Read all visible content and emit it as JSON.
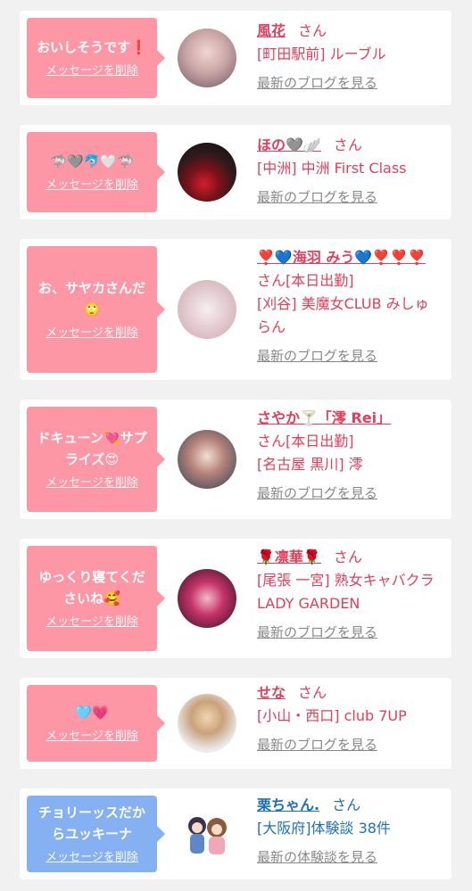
{
  "colors": {
    "pink_bubble": "#fd96a5",
    "blue_bubble": "#85b1f2",
    "name_red": "#e23f5b",
    "name_blue": "#1e6fb5",
    "link_gray": "#888888"
  },
  "delete_label": "メッセージを削除",
  "cards": [
    {
      "message": "おいしそうです❗",
      "name": "風花",
      "honorific": "さん",
      "shop": "[町田駅前] ルーブル",
      "link": "最新のブログを見る"
    },
    {
      "message": "🦈🩶🐬🤍🦈",
      "name": "ほの🩶🪽",
      "honorific": "さん",
      "shop": "[中洲] 中洲 First Class",
      "link": "最新のブログを見る"
    },
    {
      "message": "お、サヤカさんだ🙄",
      "name": "❣️💙海羽 みう💙❣️❣️❣️",
      "honorific": "さん[本日出勤]",
      "shop": "[刈谷] 美魔女CLUB みしゅらん",
      "link": "最新のブログを見る"
    },
    {
      "message": "ドキューン💘サプライズ😍",
      "name": "さやか🍸「澪 Rei」",
      "honorific": "さん[本日出勤]",
      "shop": "[名古屋 黒川] 澪",
      "link": "最新のブログを見る"
    },
    {
      "message": "ゆっくり寝てくださいね🥰",
      "name": "🌹凛華🌹",
      "honorific": "さん",
      "shop": "[尾張 一宮] 熟女キャバクラ LADY GARDEN",
      "link": "最新のブログを見る"
    },
    {
      "message": "🩵💗",
      "name": "せな",
      "honorific": "さん",
      "shop": "[小山・西口] club 7UP",
      "link": "最新のブログを見る"
    },
    {
      "message": "チョリーッスだからユッキーナ",
      "name": "栗ちゃん.",
      "honorific": "さん",
      "shop": "[大阪府]体験談 38件",
      "link": "最新の体験談を見る"
    }
  ]
}
